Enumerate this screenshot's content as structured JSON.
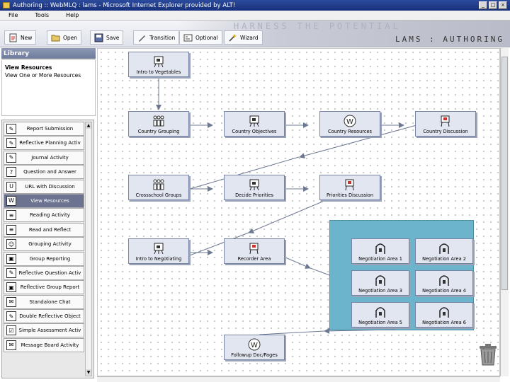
{
  "window": {
    "title": "Authoring :: WebMLQ : lams - Microsoft Internet Explorer provided by ALT!",
    "controls": [
      "_",
      "□",
      "×"
    ]
  },
  "menu": [
    "File",
    "Tools",
    "Help"
  ],
  "toolbar": {
    "buttons": [
      {
        "label": "New",
        "icon": "new-document-icon"
      },
      {
        "label": "Open",
        "icon": "folder-open-icon"
      },
      {
        "label": "Save",
        "icon": "save-disk-icon"
      },
      {
        "label": "Transition",
        "icon": "transition-pen-icon"
      },
      {
        "label": "Optional",
        "icon": "optional-icon"
      },
      {
        "label": "Wizard",
        "icon": "wizard-wand-icon"
      }
    ],
    "banner_text": "LAMS : AUTHORING",
    "banner_ghost": "HARNESS THE POTENTIAL"
  },
  "library": {
    "header": "Library",
    "info_title": "View Resources",
    "info_sub": "View One or More Resources",
    "tools": [
      {
        "label": "Report Submission",
        "glyph": "✎"
      },
      {
        "label": "Reflective Planning Activ",
        "glyph": "✎"
      },
      {
        "label": "Journal Activity",
        "glyph": "✎"
      },
      {
        "label": "Question and Answer",
        "glyph": "?"
      },
      {
        "label": "URL with Discussion",
        "glyph": "U"
      },
      {
        "label": "View Resources",
        "glyph": "W",
        "selected": true
      },
      {
        "label": "Reading Activity",
        "glyph": "≡"
      },
      {
        "label": "Read and Reflect",
        "glyph": "≡"
      },
      {
        "label": "Grouping Activity",
        "glyph": "☺"
      },
      {
        "label": "Group Reporting",
        "glyph": "▣"
      },
      {
        "label": "Reflective Question Activ",
        "glyph": "✎"
      },
      {
        "label": "Reflective Group Report",
        "glyph": "▣"
      },
      {
        "label": "Standalone Chat",
        "glyph": "✉"
      },
      {
        "label": "Double Reflective Object",
        "glyph": "✎"
      },
      {
        "label": "Simple Assessment Activ",
        "glyph": "☑"
      },
      {
        "label": "Message Board Activity",
        "glyph": "✉"
      }
    ]
  },
  "canvas": {
    "activities": [
      {
        "id": "intro-vegetables",
        "label": "Intro to Vegetables",
        "icon": "presentation-icon"
      },
      {
        "id": "country-grouping",
        "label": "Country Grouping",
        "icon": "grouping-icon"
      },
      {
        "id": "country-objectives",
        "label": "Country Objectives",
        "icon": "presentation-icon"
      },
      {
        "id": "country-resources",
        "label": "Country Resources",
        "icon": "web-resource-icon"
      },
      {
        "id": "country-discussion",
        "label": "Country Discussion",
        "icon": "discussion-icon"
      },
      {
        "id": "crossschool-groups",
        "label": "Crossschool Groups",
        "icon": "grouping-icon"
      },
      {
        "id": "decide-priorities",
        "label": "Decide Priorities",
        "icon": "presentation-icon"
      },
      {
        "id": "priorities-discussion",
        "label": "Priorities Discussion",
        "icon": "discussion-icon"
      },
      {
        "id": "intro-negotiating",
        "label": "Intro to Negotiating",
        "icon": "presentation-icon"
      },
      {
        "id": "recorder-area",
        "label": "Recorder Area",
        "icon": "discussion-icon"
      },
      {
        "id": "neg-1",
        "label": "Negotiation Area 1",
        "icon": "negotiation-icon"
      },
      {
        "id": "neg-2",
        "label": "Negotiation Area 2",
        "icon": "negotiation-icon"
      },
      {
        "id": "neg-3",
        "label": "Negotiation Area 3",
        "icon": "negotiation-icon"
      },
      {
        "id": "neg-4",
        "label": "Negotiation Area 4",
        "icon": "negotiation-icon"
      },
      {
        "id": "neg-5",
        "label": "Negotiation Area 5",
        "icon": "negotiation-icon"
      },
      {
        "id": "neg-6",
        "label": "Negotiation Area 6",
        "icon": "negotiation-icon"
      },
      {
        "id": "followup-docs",
        "label": "Followup Doc/Pages",
        "icon": "web-resource-icon"
      }
    ],
    "colors": {
      "optional_region": "#6bb4cc",
      "activity_fill": "#e2e6f1",
      "transition_line": "#6d7892"
    }
  }
}
